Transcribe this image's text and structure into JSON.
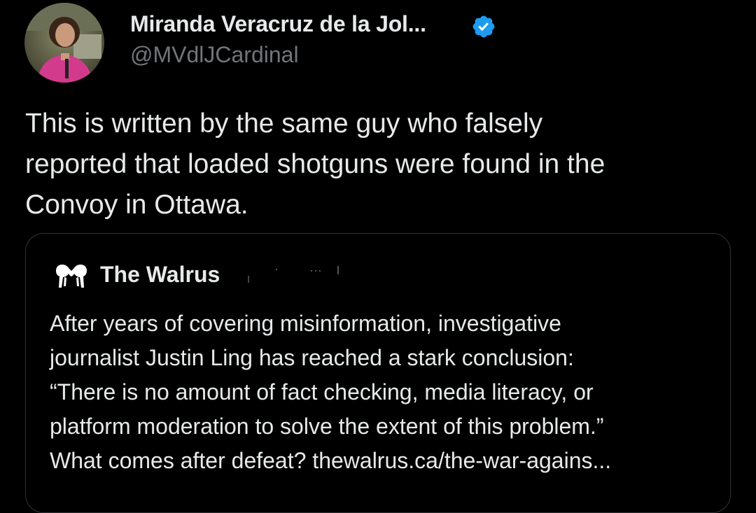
{
  "author": {
    "name": "Miranda Veracruz de la Jol...",
    "handle": "@MVdlJCardinal",
    "verified_icon": "verified-badge-icon",
    "verified_color": "#1d9bf0"
  },
  "tweet": {
    "lines": [
      "This is written by the same guy who falsely",
      "reported that loaded shotguns were found in the",
      "Convoy in Ottawa."
    ]
  },
  "quote": {
    "name": "The Walrus",
    "logo_icon": "walrus-logo-icon",
    "lines": [
      "After years of covering misinformation, investigative",
      "journalist Justin Ling has reached a stark conclusion:",
      "“There is no amount of fact checking, media literacy, or",
      "platform moderation to solve the extent of this problem.”",
      "What comes after defeat? thewalrus.ca/the-war-agains..."
    ]
  },
  "colors": {
    "background": "#000000",
    "text": "#e7e9ea",
    "secondary_text": "#71767b",
    "border": "#2f3336"
  }
}
